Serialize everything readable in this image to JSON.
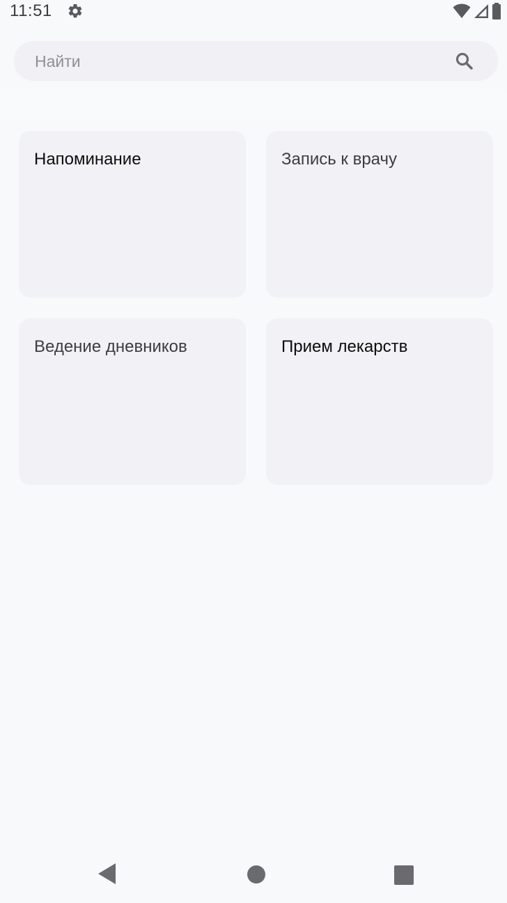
{
  "status_bar": {
    "time": "11:51",
    "icons": [
      "gear-icon",
      "wifi-icon",
      "cellular-signal-icon",
      "battery-icon"
    ]
  },
  "search": {
    "placeholder": "Найти",
    "icon": "search-icon"
  },
  "cards": [
    {
      "title": "Напоминание"
    },
    {
      "title": "Запись к врачу"
    },
    {
      "title": "Ведение дневников"
    },
    {
      "title": "Прием лекарств"
    }
  ],
  "navigation": {
    "icons": [
      "back-icon",
      "home-icon",
      "recents-icon"
    ]
  },
  "colors": {
    "background": "#f8f9fb",
    "card_background": "#f2f2f6",
    "search_background": "#f1f1f5",
    "icon_gray": "#6b6b6f"
  }
}
